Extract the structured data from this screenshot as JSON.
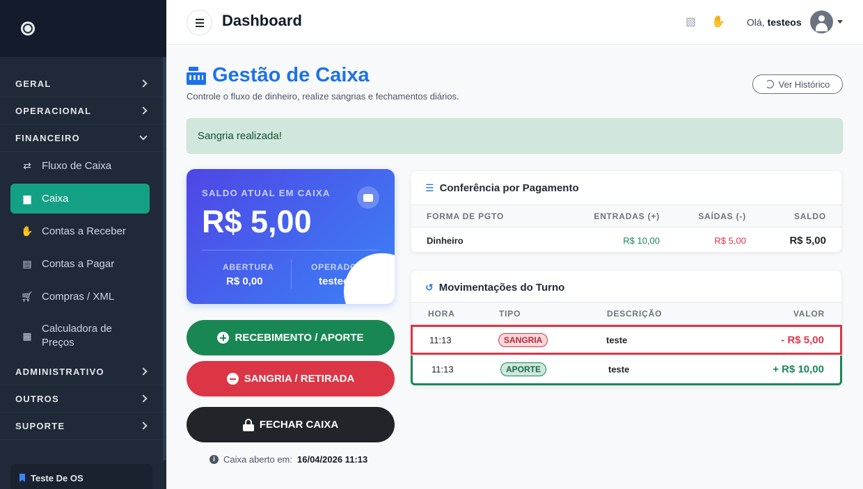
{
  "colors": {
    "sidebar_bg": "#1f2937",
    "active_item": "#14a085",
    "primary": "#1d72e8",
    "success": "#198754",
    "danger": "#dc3545",
    "dark": "#212529"
  },
  "sidebar": {
    "sections_top": [
      {
        "label": "GERAL",
        "icon": "chevron-right-icon"
      },
      {
        "label": "OPERACIONAL",
        "icon": "chevron-right-icon"
      },
      {
        "label": "FINANCEIRO",
        "icon": "chevron-down-icon"
      }
    ],
    "financeiro_items": [
      {
        "label": "Fluxo de Caixa",
        "icon": "exchange-icon"
      },
      {
        "label": "Caixa",
        "icon": "cash-register-icon",
        "active": true
      },
      {
        "label": "Contas a Receber",
        "icon": "hand-money-icon"
      },
      {
        "label": "Contas a Pagar",
        "icon": "invoice-icon"
      },
      {
        "label": "Compras / XML",
        "icon": "cart-icon"
      },
      {
        "label": "Calculadora de Preços",
        "icon": "calculator-icon"
      }
    ],
    "sections_bottom": [
      {
        "label": "ADMINISTRATIVO",
        "icon": "chevron-right-icon"
      },
      {
        "label": "OUTROS",
        "icon": "chevron-right-icon"
      },
      {
        "label": "SUPORTE",
        "icon": "chevron-right-icon"
      }
    ],
    "footer": "Teste De OS"
  },
  "topbar": {
    "title": "Dashboard",
    "greeting": "Olá,",
    "username": "testeos"
  },
  "page": {
    "title": "Gestão de Caixa",
    "subtitle": "Controle o fluxo de dinheiro, realize sangrias e fechamentos diários.",
    "history_button": "Ver Histórico",
    "alert": "Sangria realizada!"
  },
  "balance": {
    "label": "SALDO ATUAL EM CAIXA",
    "value": "R$ 5,00",
    "opening_label": "ABERTURA",
    "opening_value": "R$ 0,00",
    "operator_label": "OPERADOR",
    "operator_value": "testeos"
  },
  "actions": {
    "receive": "RECEBIMENTO / APORTE",
    "withdraw": "SANGRIA / RETIRADA",
    "close": "FECHAR CAIXA",
    "opened_label": "Caixa aberto em:",
    "opened_at": "16/04/2026 11:13"
  },
  "conferencia": {
    "title": "Conferência por Pagamento",
    "headers": [
      "FORMA DE PGTO",
      "ENTRADAS (+)",
      "SAÍDAS (-)",
      "SALDO"
    ],
    "rows": [
      {
        "forma": "Dinheiro",
        "entradas": "R$ 10,00",
        "saidas": "R$ 5,00",
        "saldo": "R$ 5,00"
      }
    ]
  },
  "movimentacoes": {
    "title": "Movimentações do Turno",
    "headers": [
      "HORA",
      "TIPO",
      "DESCRIÇÃO",
      "VALOR"
    ],
    "rows": [
      {
        "hora": "11:13",
        "tipo": "SANGRIA",
        "descricao": "teste",
        "valor": "- R$ 5,00"
      },
      {
        "hora": "11:13",
        "tipo": "APORTE",
        "descricao": "teste",
        "valor": "+ R$ 10,00"
      }
    ]
  }
}
